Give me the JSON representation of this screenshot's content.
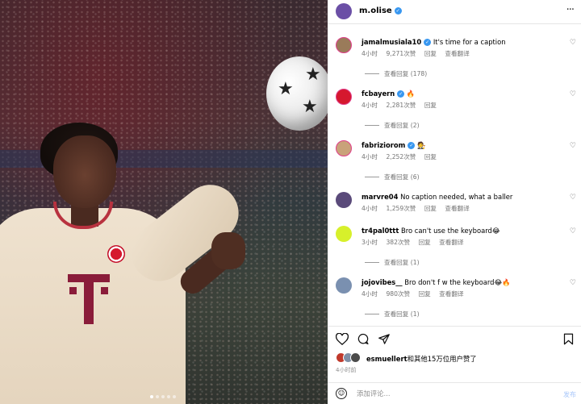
{
  "post": {
    "owner": "m.olise",
    "owner_verified": "✓",
    "more_icon": "···"
  },
  "comments": [
    {
      "user": "jamalmusiala10",
      "verified": "✓",
      "text": "It's time for a caption",
      "time": "4小时",
      "likes": "9,271次赞",
      "reply": "回复",
      "translate": "查看翻译",
      "replies": "查看回复 (178)",
      "avatar_color": "#9a7b5a"
    },
    {
      "user": "fcbayern",
      "verified": "✓",
      "text": "🔥",
      "time": "4小时",
      "likes": "2,281次赞",
      "reply": "回复",
      "translate": "",
      "replies": "查看回复 (2)",
      "avatar_color": "#d5182e"
    },
    {
      "user": "fabriziorom",
      "verified": "✓",
      "text": "🧑‍⚖️",
      "time": "4小时",
      "likes": "2,252次赞",
      "reply": "回复",
      "translate": "",
      "replies": "查看回复 (6)",
      "avatar_color": "#c9a27a"
    },
    {
      "user": "marvre04",
      "verified": "",
      "text": "No caption needed, what a baller",
      "time": "4小时",
      "likes": "1,259次赞",
      "reply": "回复",
      "translate": "查看翻译",
      "replies": "",
      "avatar_color": "#5a4a7a"
    },
    {
      "user": "tr4pal0ttt",
      "verified": "",
      "text": "Bro can't use the keyboard😂",
      "time": "3小时",
      "likes": "382次赞",
      "reply": "回复",
      "translate": "查看翻译",
      "replies": "查看回复 (1)",
      "avatar_color": "#d7f02b"
    },
    {
      "user": "jojovibes__",
      "verified": "",
      "text": "Bro don't f w the keyboard😂🔥",
      "time": "4小时",
      "likes": "980次赞",
      "reply": "回复",
      "translate": "查看翻译",
      "replies": "查看回复 (1)",
      "avatar_color": "#7a90b0"
    }
  ],
  "actions": {
    "like_icon": "heart-icon",
    "comment_icon": "comment-icon",
    "share_icon": "share-icon",
    "save_icon": "bookmark-icon"
  },
  "likes_summary": {
    "user": "esmuellert",
    "text": "和其他15万位用户赞了"
  },
  "time_ago": "4小时前",
  "comment_box": {
    "placeholder": "添加评论...",
    "post_label": "发布"
  },
  "colors": {
    "accent": "#3897f0",
    "story_ring": "#e03d8a",
    "owner_avatar": "#6b4fa6"
  }
}
